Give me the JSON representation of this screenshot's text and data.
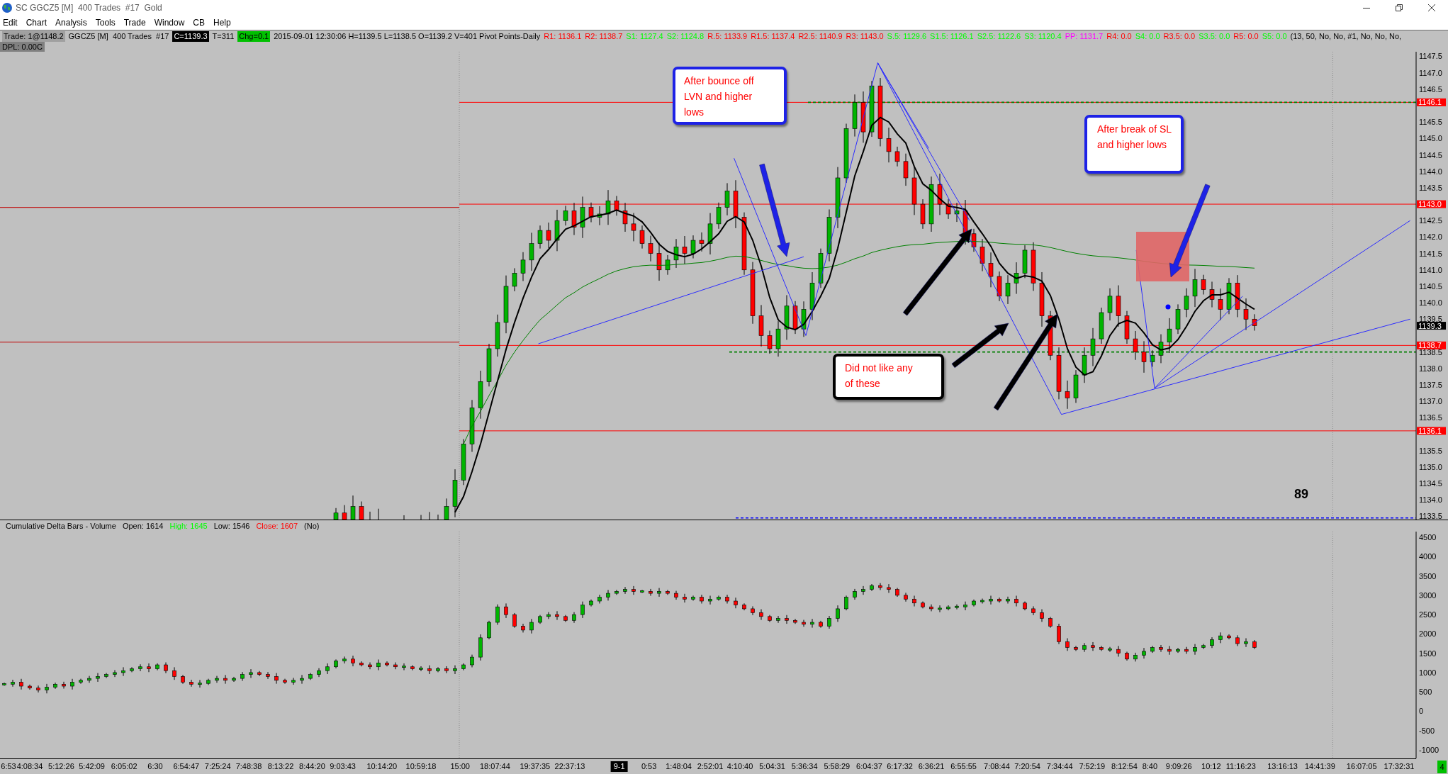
{
  "window": {
    "title": "SC GGCZ5 [M]  400 Trades  #17  Gold"
  },
  "menu": [
    "Edit",
    "Chart",
    "Analysis",
    "Tools",
    "Trade",
    "Window",
    "CB",
    "Help"
  ],
  "info_bar": {
    "items": [
      {
        "text": "Trade: 1@1148.2",
        "kind": "trade"
      },
      {
        "text": "GGCZ5 [M]  400 Trades  #17",
        "color": "#000000",
        "kind": "plain"
      },
      {
        "text": "C=1139.3",
        "kind": "price"
      },
      {
        "text": "T=311",
        "color": "#000000",
        "kind": "plain"
      },
      {
        "text": "Chg=0.1",
        "kind": "change"
      },
      {
        "text": "2015-09-01 12:30:06 H=1139.5 L=1138.5 O=1139.2 V=401 Pivot Points-Daily",
        "color": "#000000",
        "kind": "plain"
      },
      {
        "text": "R1: 1136.1",
        "color": "#ff0000",
        "kind": "plain"
      },
      {
        "text": "R2: 1138.7",
        "color": "#ff0000",
        "kind": "plain"
      },
      {
        "text": "S1: 1127.4",
        "color": "#00ff00",
        "kind": "plain"
      },
      {
        "text": "S2: 1124.8",
        "color": "#00ff00",
        "kind": "plain"
      },
      {
        "text": "R.5: 1133.9",
        "color": "#ff0000",
        "kind": "plain"
      },
      {
        "text": "R1.5: 1137.4",
        "color": "#ff0000",
        "kind": "plain"
      },
      {
        "text": "R2.5: 1140.9",
        "color": "#ff0000",
        "kind": "plain"
      },
      {
        "text": "R3: 1143.0",
        "color": "#ff0000",
        "kind": "plain"
      },
      {
        "text": "S.5: 1129.6",
        "color": "#00ff00",
        "kind": "plain"
      },
      {
        "text": "S1.5: 1126.1",
        "color": "#00ff00",
        "kind": "plain"
      },
      {
        "text": "S2.5: 1122.6",
        "color": "#00ff00",
        "kind": "plain"
      },
      {
        "text": "S3: 1120.4",
        "color": "#00ff00",
        "kind": "plain"
      },
      {
        "text": "PP: 1131.7",
        "color": "#ff00ff",
        "kind": "plain"
      },
      {
        "text": "R4: 0.0",
        "color": "#ff0000",
        "kind": "plain"
      },
      {
        "text": "S4: 0.0",
        "color": "#00ff00",
        "kind": "plain"
      },
      {
        "text": "R3.5: 0.0",
        "color": "#ff0000",
        "kind": "plain"
      },
      {
        "text": "S3.5: 0.0",
        "color": "#00ff00",
        "kind": "plain"
      },
      {
        "text": "R5: 0.0",
        "color": "#ff0000",
        "kind": "plain"
      },
      {
        "text": "S5: 0.0",
        "color": "#00ff00",
        "kind": "plain"
      },
      {
        "text": "(13, 50, No, No, #1, No, No, No,",
        "color": "#000000",
        "kind": "plain"
      }
    ],
    "second_row": "DPL: 0.00C"
  },
  "price_pane": {
    "axis_labels": [
      "1147.5",
      "1147.0",
      "1146.5",
      "1145.5",
      "1145.0",
      "1144.5",
      "1144.0",
      "1143.5",
      "1142.5",
      "1142.0",
      "1141.5",
      "1141.0",
      "1140.5",
      "1140.0",
      "1139.5",
      "1138.5",
      "1138.0",
      "1137.5",
      "1137.0",
      "1136.5",
      "1135.5",
      "1135.0",
      "1134.5",
      "1134.0",
      "1133.5"
    ],
    "markers": [
      {
        "label": "1146.1",
        "color": "#ff0000"
      },
      {
        "label": "1143.0",
        "color": "#ff0000"
      },
      {
        "label": "1139.3",
        "color": "#000000"
      },
      {
        "label": "1138.7",
        "color": "#ff0000"
      },
      {
        "label": "1136.1",
        "color": "#ff0000"
      }
    ],
    "callouts": [
      {
        "text": "After bounce off LVN and higher lows",
        "color": "#1e22e6"
      },
      {
        "text": "After break of SL and higher lows",
        "color": "#1e22e6"
      },
      {
        "text": "Did not like any of these",
        "color": "#000000"
      }
    ],
    "corner_label": "89"
  },
  "delta_pane": {
    "title": "Cumulative Delta Bars - Volume",
    "readings": [
      {
        "text": "Open: 1614"
      },
      {
        "text": "High: 1645",
        "color": "#00ff00"
      },
      {
        "text": "Low: 1546"
      },
      {
        "text": "Close: 1607",
        "color": "#ff0000"
      },
      {
        "text": "(No)"
      }
    ],
    "axis_labels": [
      "4500",
      "4000",
      "3500",
      "3000",
      "2500",
      "2000",
      "1500",
      "1000",
      "500",
      "0",
      "-500",
      "-1000"
    ],
    "corner_badge": "4"
  },
  "time_axis": [
    {
      "label": "6:53",
      "kind": "time"
    },
    {
      "label": "4:08:34",
      "kind": "time"
    },
    {
      "label": "5:12:26",
      "kind": "time"
    },
    {
      "label": "5:42:09",
      "kind": "time"
    },
    {
      "label": "6:05:02",
      "kind": "time"
    },
    {
      "label": "6:30",
      "kind": "time"
    },
    {
      "label": "6:54:47",
      "kind": "time"
    },
    {
      "label": "7:25:24",
      "kind": "time"
    },
    {
      "label": "7:48:38",
      "kind": "time"
    },
    {
      "label": "8:13:22",
      "kind": "time"
    },
    {
      "label": "8:44:20",
      "kind": "time"
    },
    {
      "label": "9:03:43",
      "kind": "time"
    },
    {
      "label": "10:14:20",
      "kind": "time"
    },
    {
      "label": "10:59:18",
      "kind": "time"
    },
    {
      "label": "15:00",
      "kind": "time"
    },
    {
      "label": "18:07:44",
      "kind": "time"
    },
    {
      "label": "19:37:35",
      "kind": "time"
    },
    {
      "label": "22:37:13",
      "kind": "time"
    },
    {
      "label": "9-1",
      "kind": "date"
    },
    {
      "label": "0:53",
      "kind": "time"
    },
    {
      "label": "1:48:04",
      "kind": "time"
    },
    {
      "label": "2:52:01",
      "kind": "time"
    },
    {
      "label": "4:10:40",
      "kind": "time"
    },
    {
      "label": "5:04:31",
      "kind": "time"
    },
    {
      "label": "5:36:34",
      "kind": "time"
    },
    {
      "label": "5:58:29",
      "kind": "time"
    },
    {
      "label": "6:04:37",
      "kind": "time"
    },
    {
      "label": "6:17:32",
      "kind": "time"
    },
    {
      "label": "6:36:21",
      "kind": "time"
    },
    {
      "label": "6:55:55",
      "kind": "time"
    },
    {
      "label": "7:08:44",
      "kind": "time"
    },
    {
      "label": "7:20:54",
      "kind": "time"
    },
    {
      "label": "7:34:44",
      "kind": "time"
    },
    {
      "label": "7:52:19",
      "kind": "time"
    },
    {
      "label": "8:12:54",
      "kind": "time"
    },
    {
      "label": "8:40",
      "kind": "time"
    },
    {
      "label": "9:09:26",
      "kind": "time"
    },
    {
      "label": "10:12",
      "kind": "time"
    },
    {
      "label": "11:16:23",
      "kind": "time"
    },
    {
      "label": "13:16:13",
      "kind": "time"
    },
    {
      "label": "14:41:39",
      "kind": "time"
    },
    {
      "label": "16:07:05",
      "kind": "time"
    },
    {
      "label": "17:32:31",
      "kind": "time"
    }
  ]
}
